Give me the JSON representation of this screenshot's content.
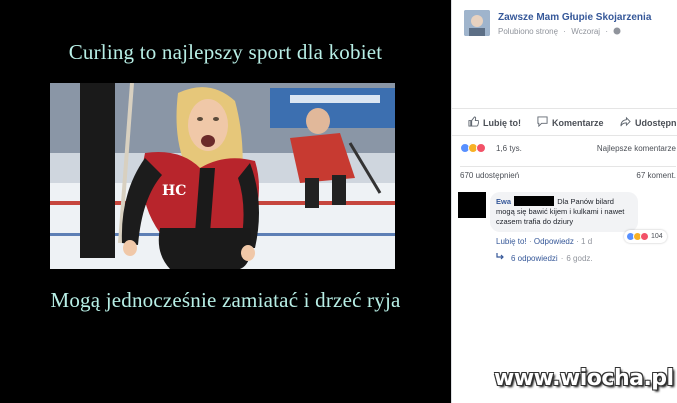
{
  "meme": {
    "caption_top": "Curling to najlepszy sport dla kobiet",
    "caption_bottom": "Mogą jednocześnie zamiatać i drzeć ryja",
    "photo": {
      "jersey_letters": "HC"
    }
  },
  "post": {
    "page_name": "Zawsze Mam Głupie Skojarzenia",
    "meta_liked": "Polubiono stronę",
    "meta_time": "Wczoraj",
    "meta_sep": "·",
    "actions": {
      "like": "Lubię to!",
      "comment": "Komentarze",
      "share": "Udostępnij"
    },
    "reactions": {
      "count": "1,6 tys.",
      "top_comments": "Najlepsze komentarze",
      "colors": [
        "#5890ff",
        "#f7b125",
        "#f25268"
      ]
    },
    "shares": "670 udostępnień",
    "comments_count": "67 koment."
  },
  "comment": {
    "author": "Ewa",
    "text": "Dla Panów bilard mogą się bawić kijem i kulkami i nawet czasem trafia do dziury",
    "reaction_count": "104",
    "like_link": "Lubię to!",
    "reply_link": "Odpowiedz",
    "time": "1 d",
    "sep": "·",
    "replies": "6 odpowiedzi",
    "replies_time": "6 godz."
  },
  "watermark": "www.wiocha.pl",
  "colors": {
    "caption": "#b8efe6",
    "fb_link": "#365899",
    "fb_meta": "#90949c"
  }
}
